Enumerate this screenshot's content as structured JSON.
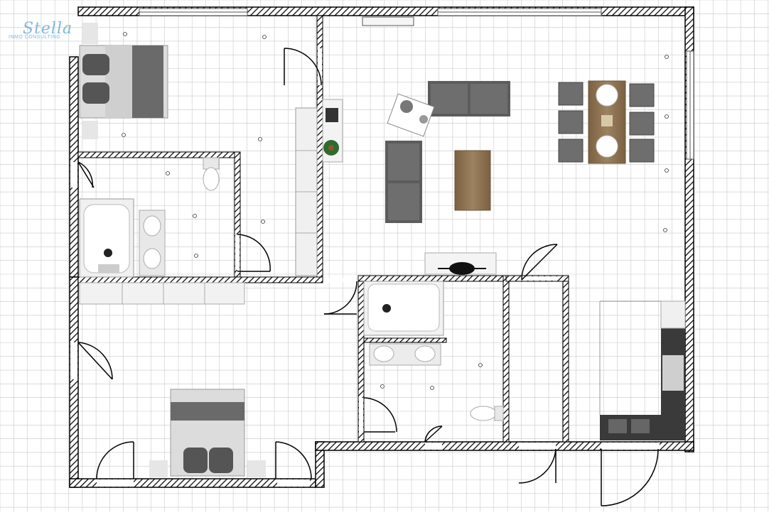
{
  "logo": {
    "title": "Stella",
    "subtitle": "INMO CONSULTING"
  },
  "colors": {
    "grid": "#c8c8c8",
    "wall": "#000000",
    "furniture_dark": "#6a6a6a",
    "furniture_light": "#e6e6e6",
    "wood": "#8a6f4d",
    "accent": "#7fb8d8"
  }
}
